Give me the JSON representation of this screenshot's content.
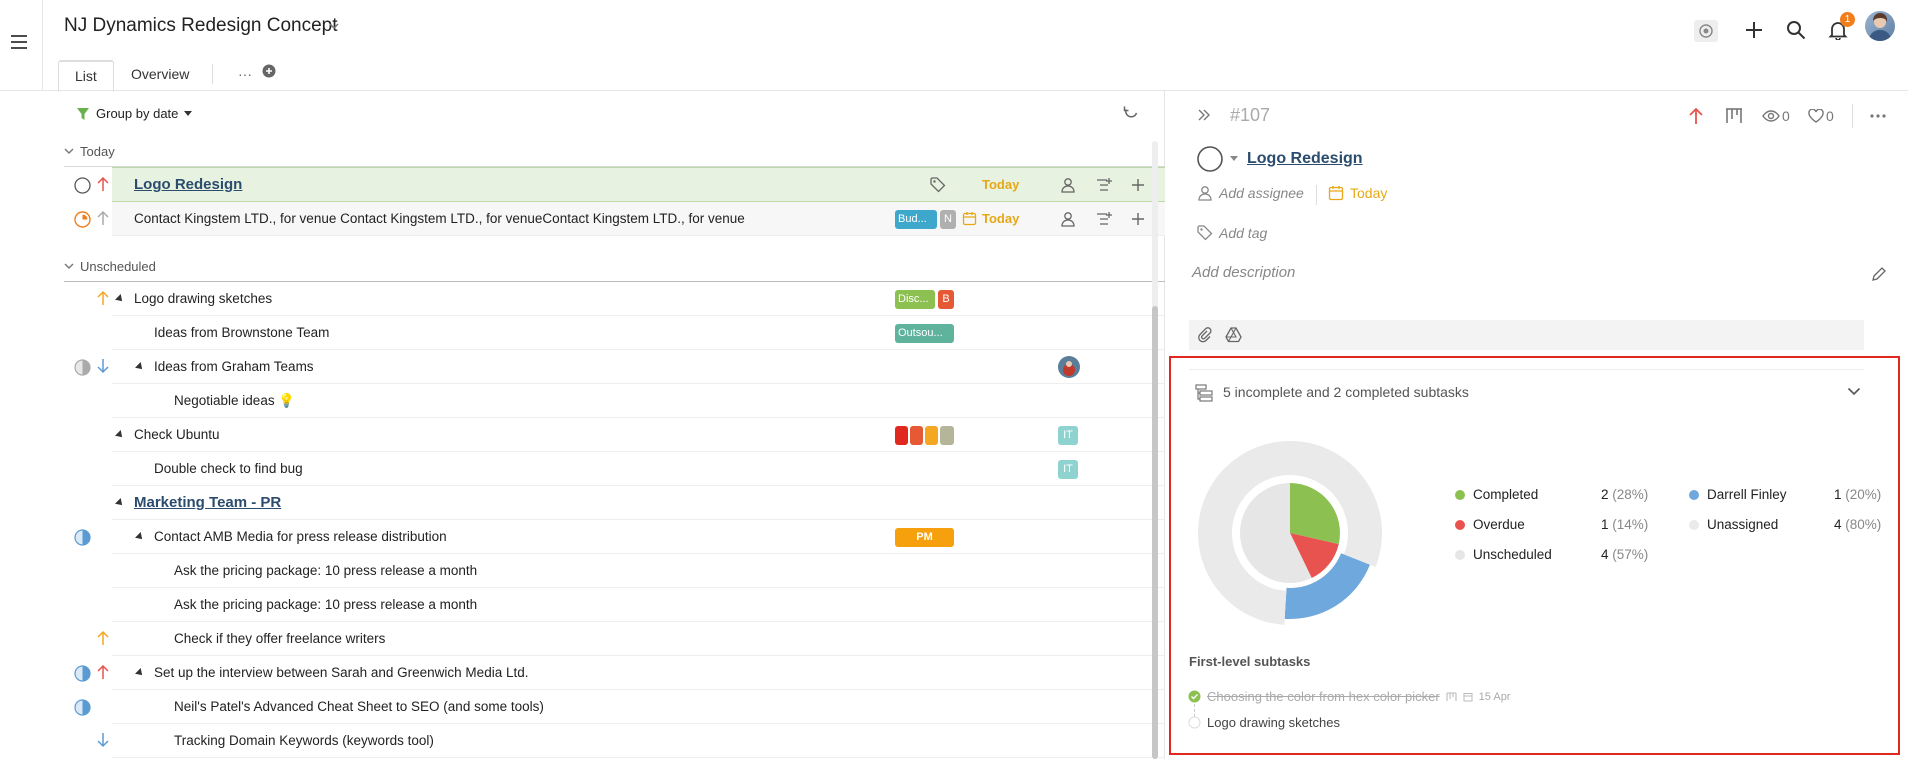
{
  "header": {
    "project_title": "NJ Dynamics Redesign Concept",
    "tabs": [
      {
        "label": "List"
      },
      {
        "label": "Overview"
      },
      {
        "label": "···"
      }
    ],
    "notifications_count": "1"
  },
  "list": {
    "group_by_label": "Group by date",
    "sections": {
      "today": "Today",
      "unscheduled": "Unscheduled"
    },
    "rows": [
      {
        "title": "Logo Redesign",
        "due": "Today"
      },
      {
        "title": "Contact Kingstem LTD., for venue Contact Kingstem LTD., for venueContact Kingstem LTD., for venue",
        "tags": [
          "Bud...",
          "N"
        ],
        "due": "Today"
      },
      {
        "title": "Logo drawing sketches",
        "tags": [
          "Disc...",
          "B"
        ]
      },
      {
        "title": "Ideas from Brownstone Team",
        "tags": [
          "Outsou..."
        ]
      },
      {
        "title": "Ideas from Graham Teams"
      },
      {
        "title": "Negotiable ideas 💡"
      },
      {
        "title": "Check Ubuntu",
        "badge": "IT"
      },
      {
        "title": "Double check to find bug",
        "badge": "IT"
      },
      {
        "title": "Marketing Team - PR"
      },
      {
        "title": "Contact AMB Media for press release distribution",
        "tags": [
          "PM"
        ]
      },
      {
        "title": "Ask the pricing package: 10 press release a month"
      },
      {
        "title": "Ask the pricing package: 10 press release a month"
      },
      {
        "title": "Check if they offer freelance writers"
      },
      {
        "title": "Set up the interview between Sarah and Greenwich Media Ltd."
      },
      {
        "title": "Neil's Patel's Advanced Cheat Sheet to SEO (and some tools)"
      },
      {
        "title": "Tracking Domain Keywords (keywords tool)"
      }
    ]
  },
  "detail": {
    "task_number": "#107",
    "watchers": "0",
    "likes": "0",
    "title": "Logo Redesign",
    "add_assignee": "Add assignee",
    "due": "Today",
    "add_tag": "Add tag",
    "add_description": "Add description",
    "subtasks_summary": "5 incomplete and 2 completed subtasks",
    "first_level_label": "First-level subtasks",
    "subtasks": [
      {
        "title": "Choosing the color from hex color picker",
        "date": "15 Apr",
        "completed": true
      },
      {
        "title": "Logo drawing sketches",
        "completed": false
      }
    ]
  },
  "chart_data": {
    "type": "pie",
    "status": [
      {
        "name": "Completed",
        "count": 2,
        "percent": "(28%)",
        "color": "#8cc152"
      },
      {
        "name": "Overdue",
        "count": 1,
        "percent": "(14%)",
        "color": "#e9534f"
      },
      {
        "name": "Unscheduled",
        "count": 4,
        "percent": "(57%)",
        "color": "#e6e6e6"
      }
    ],
    "assignees": [
      {
        "name": "Darrell Finley",
        "count": 1,
        "percent": "(20%)",
        "color": "#6fa8dc"
      },
      {
        "name": "Unassigned",
        "count": 4,
        "percent": "(80%)",
        "color": "#eaeaea"
      }
    ]
  },
  "colors": {
    "accent": "#2b4c6e",
    "today": "#e6a817",
    "highlight": "#e8f2e0",
    "border_alert": "#e0281f"
  }
}
